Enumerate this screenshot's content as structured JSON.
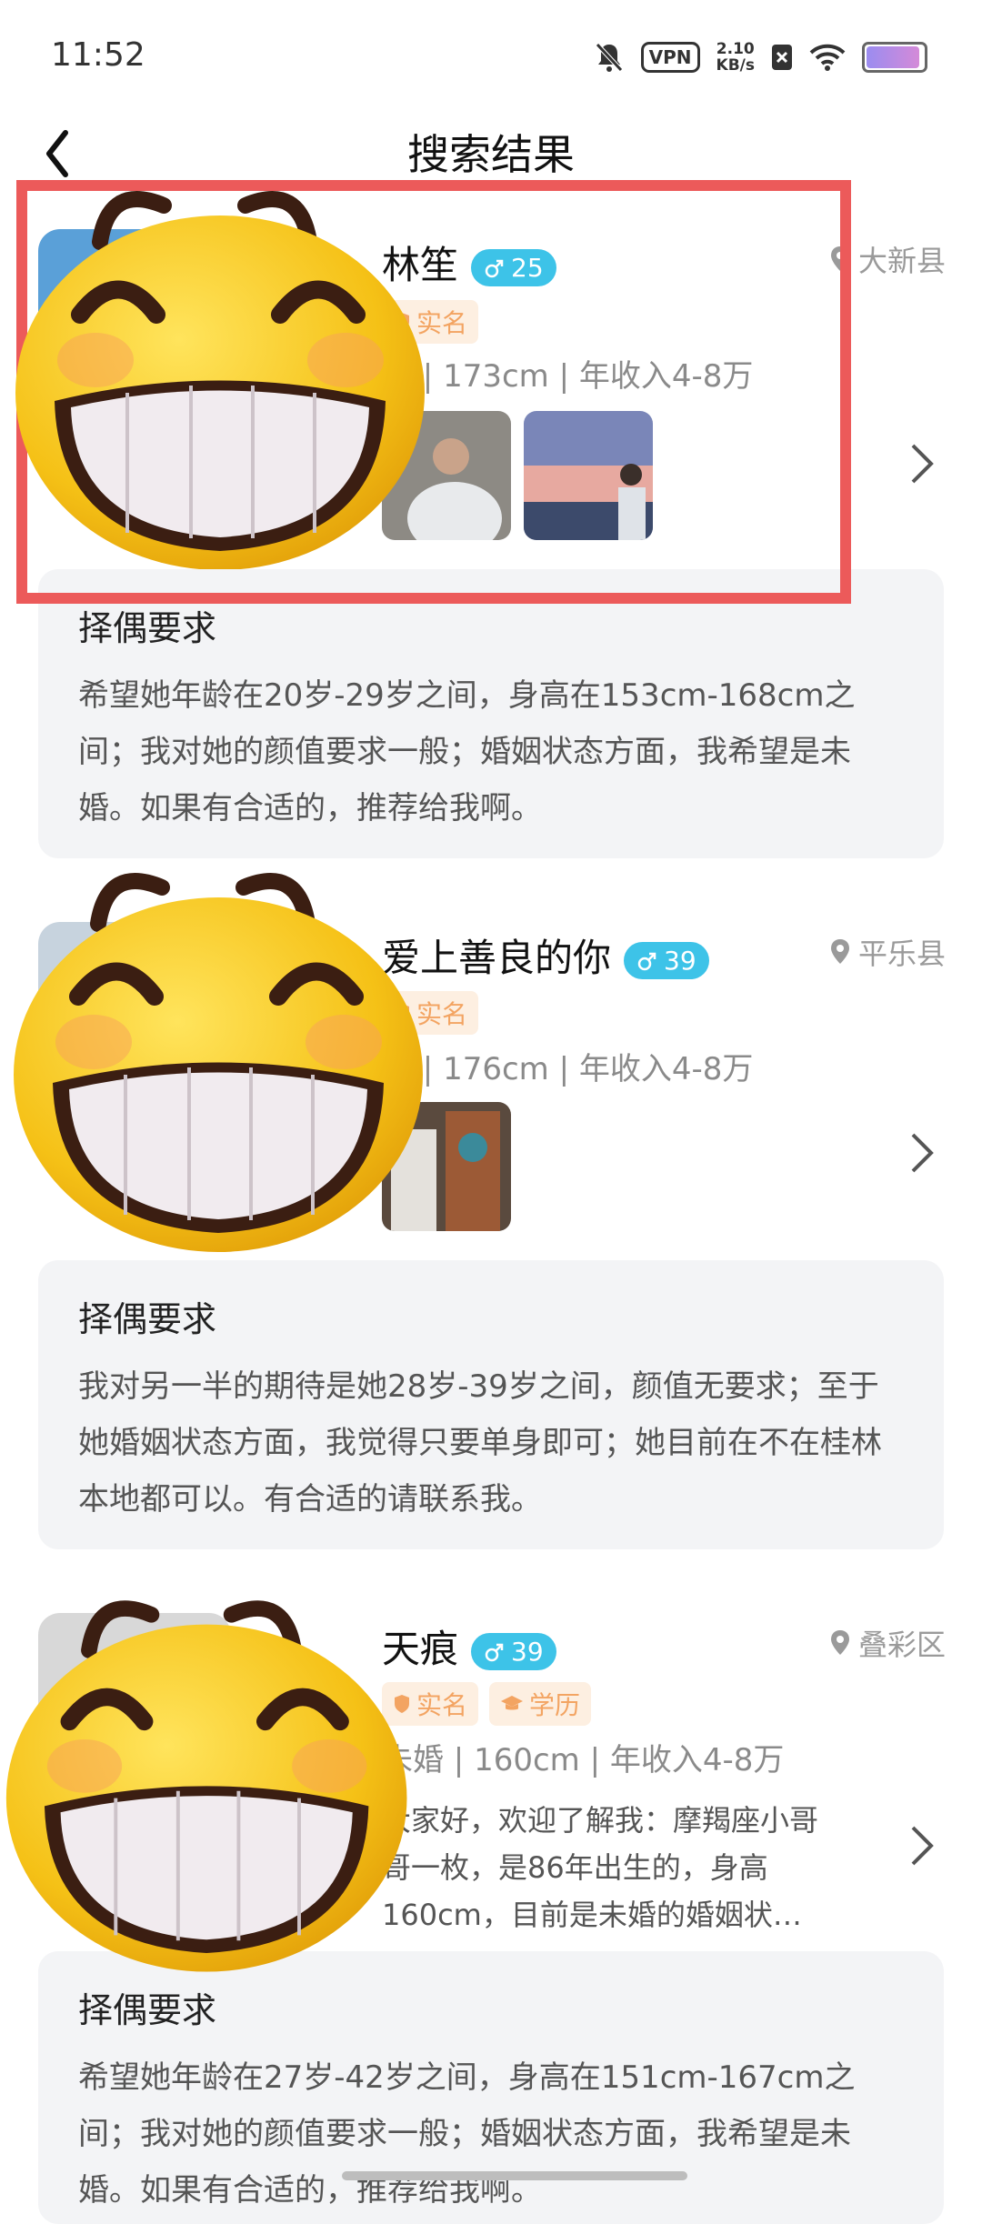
{
  "status_bar": {
    "time": "11:52",
    "vpn": "VPN",
    "speed_value": "2.10",
    "speed_unit": "KB/s"
  },
  "header": {
    "title": "搜索结果"
  },
  "results": [
    {
      "name": "林笙",
      "age": "25",
      "location": "大新县",
      "tags": [
        "实名"
      ],
      "info": "婚 | 173cm | 年收入4-8万",
      "req_title": "择偶要求",
      "req_text": "希望她年龄在20岁-29岁之间，身高在153cm-168cm之间；我对她的颜值要求一般；婚姻状态方面，我希望是未婚。如果有合适的，推荐给我啊。"
    },
    {
      "name": "爱上善良的你",
      "age": "39",
      "location": "平乐县",
      "tags": [
        "实名"
      ],
      "info": "婚 | 176cm | 年收入4-8万",
      "req_title": "择偶要求",
      "req_text": "我对另一半的期待是她28岁-39岁之间，颜值无要求；至于她婚姻状态方面，我觉得只要单身即可；她目前在不在桂林本地都可以。有合适的请联系我。"
    },
    {
      "name": "天痕",
      "age": "39",
      "location": "叠彩区",
      "tags": [
        "实名",
        "学历"
      ],
      "info": "未婚 | 160cm | 年收入4-8万",
      "intro": "大家好，欢迎了解我：摩羯座小哥哥一枚，是86年出生的，身高160cm，目前是未婚的婚姻状…",
      "req_title": "择偶要求",
      "req_text": "希望她年龄在27岁-42岁之间，身高在151cm-167cm之间；我对她的颜值要求一般；婚姻状态方面，我希望是未婚。如果有合适的，推荐给我啊。"
    }
  ],
  "icons": {
    "back": "back-arrow-icon",
    "location": "location-pin-icon",
    "male": "male-icon",
    "chevron": "chevron-right-icon",
    "verified": "shield-icon",
    "education": "graduation-cap-icon"
  }
}
